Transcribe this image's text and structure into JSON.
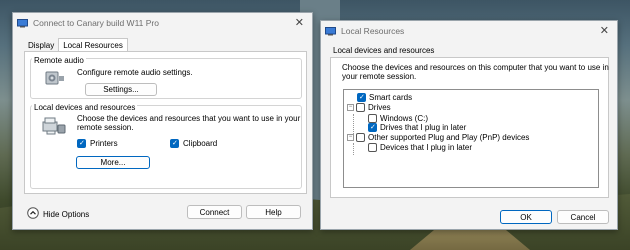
{
  "left_window": {
    "title": "Connect to Canary build W11 Pro",
    "close_glyph": "✕",
    "tabs": [
      {
        "label": "Display"
      },
      {
        "label": "Local Resources"
      }
    ],
    "remote_audio": {
      "heading": "Remote audio",
      "description": "Configure remote audio settings.",
      "settings_button": "Settings..."
    },
    "local_devices": {
      "heading": "Local devices and resources",
      "description_line1": "Choose the devices and resources that you want to use in your",
      "description_line2": "remote session.",
      "printers_label": "Printers",
      "clipboard_label": "Clipboard",
      "more_button": "More..."
    },
    "hide_options_label": "Hide Options",
    "connect_button": "Connect",
    "help_button": "Help"
  },
  "right_window": {
    "title": "Local Resources",
    "close_glyph": "✕",
    "heading": "Local devices and resources",
    "description_line1": "Choose the devices and resources on this computer that you want to use in",
    "description_line2": "your remote session.",
    "tree": {
      "smart_cards": "Smart cards",
      "drives": "Drives",
      "windows_c": "Windows (C:)",
      "drives_plug_in_later": "Drives that I plug in later",
      "other_pnp": "Other supported Plug and Play (PnP) devices",
      "devices_plug_in_later": "Devices that I plug in later",
      "expander_glyph": "−"
    },
    "ok_button": "OK",
    "cancel_button": "Cancel"
  },
  "colors": {
    "accent": "#0067c0",
    "window_bg": "#f3f3f3"
  }
}
